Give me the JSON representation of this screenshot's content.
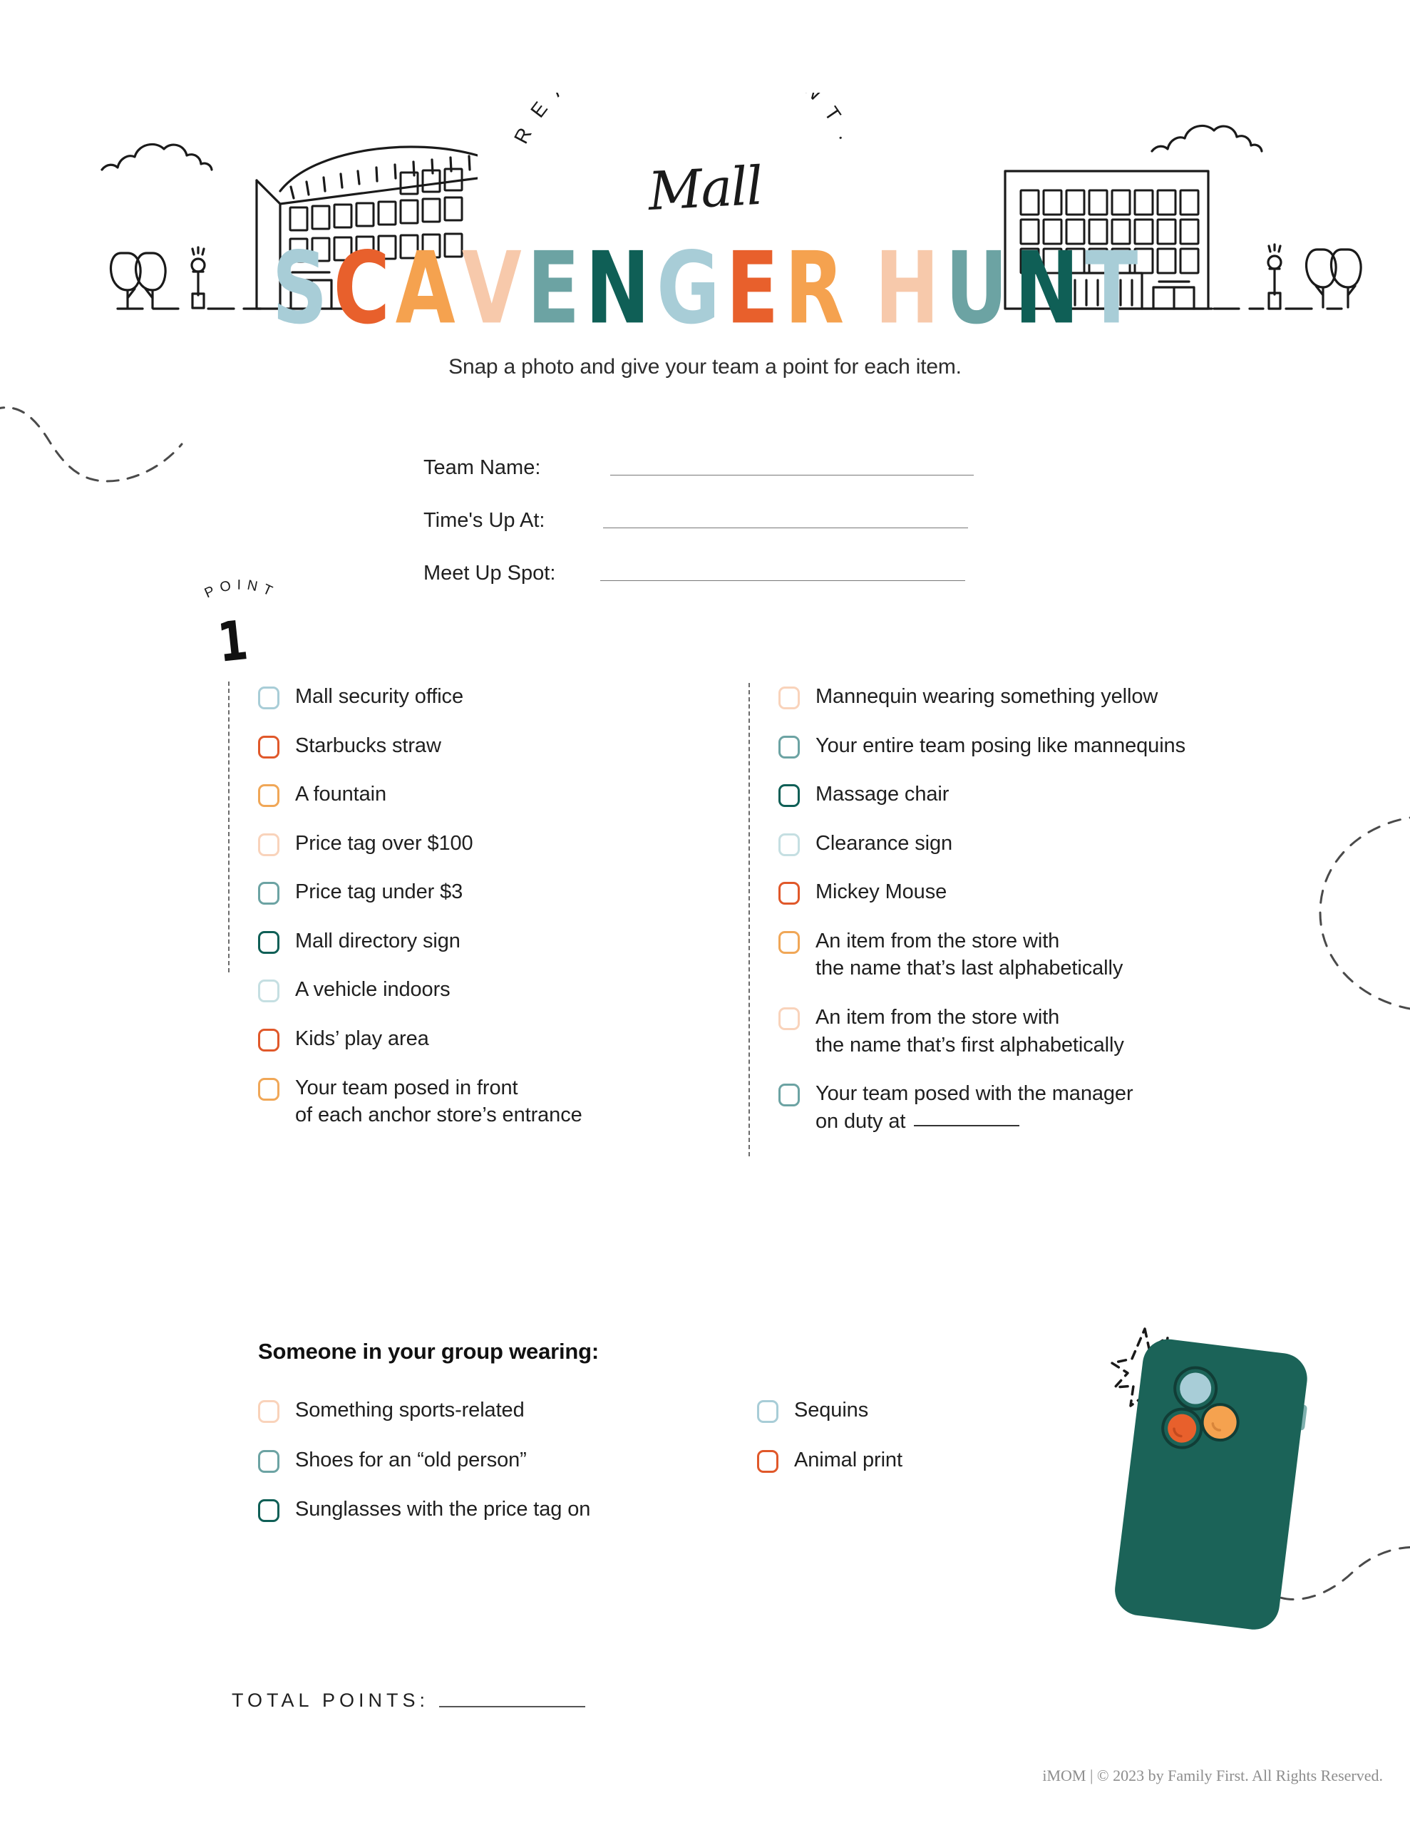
{
  "header": {
    "arc_text": "R E A D Y .   S E T .   H U N T .",
    "script_word": "Mall",
    "title_letters": [
      {
        "ch": "S",
        "color": "#a8cdd7"
      },
      {
        "ch": "C",
        "color": "#e8602c"
      },
      {
        "ch": "A",
        "color": "#f5a24f"
      },
      {
        "ch": "V",
        "color": "#f7c9ab"
      },
      {
        "ch": "E",
        "color": "#6ca3a3"
      },
      {
        "ch": "N",
        "color": "#0f5f56"
      },
      {
        "ch": "G",
        "color": "#a8cdd7"
      },
      {
        "ch": "E",
        "color": "#e8602c"
      },
      {
        "ch": "R",
        "color": "#f5a24f"
      },
      {
        "ch": " ",
        "color": "transparent"
      },
      {
        "ch": "H",
        "color": "#f7c9ab"
      },
      {
        "ch": "U",
        "color": "#6ca3a3"
      },
      {
        "ch": "N",
        "color": "#0f5f56"
      },
      {
        "ch": "T",
        "color": "#a8cdd7"
      }
    ],
    "title_plain": "SCAVENGER HUNT",
    "subtitle": "Snap a photo and give your team a point for each item."
  },
  "form": {
    "fields": [
      {
        "label": "Team Name:",
        "value": "",
        "placeholder": ""
      },
      {
        "label": "Time's Up At:",
        "value": "",
        "placeholder": ""
      },
      {
        "label": "Meet Up Spot:",
        "value": "",
        "placeholder": ""
      }
    ]
  },
  "point_badge": {
    "word": "POINT",
    "letters": [
      "P",
      "O",
      "I",
      "N",
      "T"
    ],
    "number": "1"
  },
  "checklist": {
    "left_column": [
      {
        "text": "Mall security office",
        "color": "#a8cdd7"
      },
      {
        "text": "Starbucks straw",
        "color": "#e0582a"
      },
      {
        "text": "A fountain",
        "color": "#f0a757"
      },
      {
        "text": "Price tag over $100",
        "color": "#f9d3bb"
      },
      {
        "text": "Price tag under $3",
        "color": "#6ca3a3"
      },
      {
        "text": "Mall directory sign",
        "color": "#0f5f56"
      },
      {
        "text": "A vehicle indoors",
        "color": "#c5dfe2"
      },
      {
        "text": "Kids’ play area",
        "color": "#e0582a"
      },
      {
        "text": "Your team posed in front\nof each anchor store’s entrance",
        "color": "#f0a757"
      }
    ],
    "right_column": [
      {
        "text": "Mannequin wearing something yellow",
        "color": "#f9d3bb"
      },
      {
        "text": "Your entire team posing like mannequins",
        "color": "#6ca3a3"
      },
      {
        "text": "Massage chair",
        "color": "#0f5f56"
      },
      {
        "text": "Clearance sign",
        "color": "#c5dfe2"
      },
      {
        "text": "Mickey Mouse",
        "color": "#e0582a"
      },
      {
        "text": "An item from the store with\nthe name that’s last alphabetically",
        "color": "#f0a757"
      },
      {
        "text": "An item from the store with\nthe name that’s first alphabetically",
        "color": "#f9d3bb"
      },
      {
        "text": "Your team posed with the manager\non duty at ____________",
        "color": "#6ca3a3",
        "has_blank": true,
        "prefix_line2": "on duty at"
      }
    ]
  },
  "wearing": {
    "title": "Someone in your group wearing:",
    "left_items": [
      {
        "text": "Something sports-related",
        "color": "#f9d3bb"
      },
      {
        "text": "Shoes for an “old person”",
        "color": "#6ca3a3"
      },
      {
        "text": "Sunglasses with the price tag on",
        "color": "#0f5f56"
      }
    ],
    "right_items": [
      {
        "text": "Sequins",
        "color": "#a8cdd7"
      },
      {
        "text": "Animal print",
        "color": "#e0582a"
      }
    ]
  },
  "totals": {
    "label": "TOTAL POINTS:"
  },
  "footer": {
    "text": "iMOM | © 2023 by Family First. All Rights Reserved."
  },
  "illustration": {
    "phone_body_color": "#1b6358",
    "lens_blue": "#a8cdd7",
    "lens_orange": "#e8602c",
    "lens_yellow": "#f5a24f",
    "outline_color": "#1a1a1a"
  },
  "palette": {
    "teal_dark": "#0f5f56",
    "teal_mid": "#6ca3a3",
    "blue_light": "#a8cdd7",
    "blue_pale": "#c5dfe2",
    "orange": "#e8602c",
    "orange_deep": "#e0582a",
    "yellow": "#f5a24f",
    "yellow_mid": "#f0a757",
    "peach": "#f7c9ab",
    "peach_pale": "#f9d3bb",
    "ink": "#1a1a1a",
    "rule": "#777777"
  }
}
